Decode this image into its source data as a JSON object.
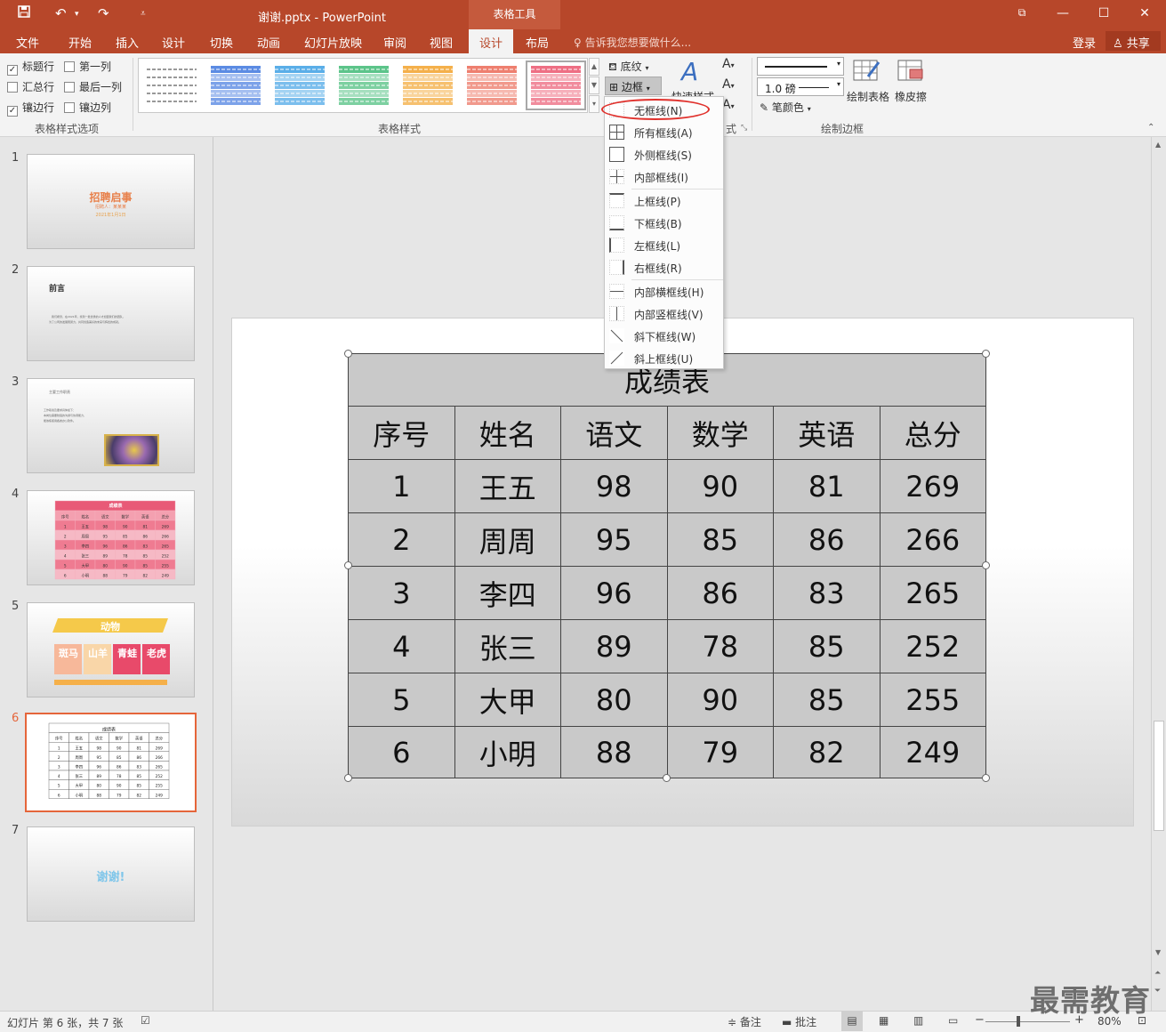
{
  "titlebar": {
    "doc_title": "谢谢.pptx - PowerPoint",
    "context_tab": "表格工具",
    "save_icon": "save-icon",
    "undo_icon": "undo-icon",
    "redo_icon": "redo-icon",
    "customize_icon": "customize-icon"
  },
  "tabs": [
    {
      "label": "文件"
    },
    {
      "label": "开始"
    },
    {
      "label": "插入"
    },
    {
      "label": "设计"
    },
    {
      "label": "切换"
    },
    {
      "label": "动画"
    },
    {
      "label": "幻灯片放映"
    },
    {
      "label": "审阅"
    },
    {
      "label": "视图"
    },
    {
      "label": "设计"
    },
    {
      "label": "布局"
    }
  ],
  "tell_me": "告诉我您想要做什么...",
  "login": "登录",
  "share": "共享",
  "ribbon": {
    "options": {
      "header_row": "标题行",
      "first_column": "第一列",
      "total_row": "汇总行",
      "last_column": "最后一列",
      "banded_rows": "镶边行",
      "banded_columns": "镶边列",
      "group_label": "表格样式选项"
    },
    "styles_group_label": "表格样式",
    "shading": "底纹",
    "border": "边框",
    "quick_styles": "快速样式",
    "wordart_group_label": "式",
    "pen_weight": "1.0 磅",
    "pen_color": "笔颜色",
    "draw_table": "绘制表格",
    "eraser": "橡皮擦",
    "draw_borders_group_label": "绘制边框"
  },
  "style_colors": [
    "#ffffff",
    "#5b8be3",
    "#5aaee8",
    "#5cc48a",
    "#f4b04b",
    "#ee7f6f",
    "#ee6f84"
  ],
  "border_menu": [
    {
      "label": "无框线(N)"
    },
    {
      "label": "所有框线(A)"
    },
    {
      "label": "外侧框线(S)"
    },
    {
      "label": "内部框线(I)"
    },
    {
      "label": "上框线(P)"
    },
    {
      "label": "下框线(B)"
    },
    {
      "label": "左框线(L)"
    },
    {
      "label": "右框线(R)"
    },
    {
      "label": "内部横框线(H)"
    },
    {
      "label": "内部竖框线(V)"
    },
    {
      "label": "斜下框线(W)"
    },
    {
      "label": "斜上框线(U)"
    }
  ],
  "slides": [
    {
      "num": "1",
      "title": "招聘启事",
      "sub1": "招聘人：某某某",
      "sub2": "2021年1月1日"
    },
    {
      "num": "2",
      "title": "前言",
      "body1": "我们希望，在2021年，找到一批优秀的人才加盟我们的团队，",
      "body2": "为了公司的发展而努力，共同创造美好的未来与辉煌的成就。"
    },
    {
      "num": "3",
      "title": "主要工作职责",
      "body1": "工作职责及要求具体如下：",
      "body2": "本岗位需要较强的沟通与协调能力，",
      "body3": "能熟练使用各类办公软件。"
    },
    {
      "num": "4",
      "title": "成绩表"
    },
    {
      "num": "5",
      "title": "动物",
      "cells": [
        "斑马",
        "山羊",
        "青蛙",
        "老虎"
      ]
    },
    {
      "num": "6",
      "title": "成绩表"
    },
    {
      "num": "7",
      "title": "谢谢!"
    }
  ],
  "grade_table": {
    "title": "成绩表",
    "headers": [
      "序号",
      "姓名",
      "语文",
      "数学",
      "英语",
      "总分"
    ],
    "rows": [
      [
        "1",
        "王五",
        "98",
        "90",
        "81",
        "269"
      ],
      [
        "2",
        "周周",
        "95",
        "85",
        "86",
        "266"
      ],
      [
        "3",
        "李四",
        "96",
        "86",
        "83",
        "265"
      ],
      [
        "4",
        "张三",
        "89",
        "78",
        "85",
        "252"
      ],
      [
        "5",
        "大甲",
        "80",
        "90",
        "85",
        "255"
      ],
      [
        "6",
        "小明",
        "88",
        "79",
        "82",
        "249"
      ]
    ]
  },
  "statusbar": {
    "slide_info": "幻灯片 第 6 张，共 7 张",
    "notes": "备注",
    "comments": "批注",
    "zoom": "80%"
  },
  "watermark": "最需教育"
}
